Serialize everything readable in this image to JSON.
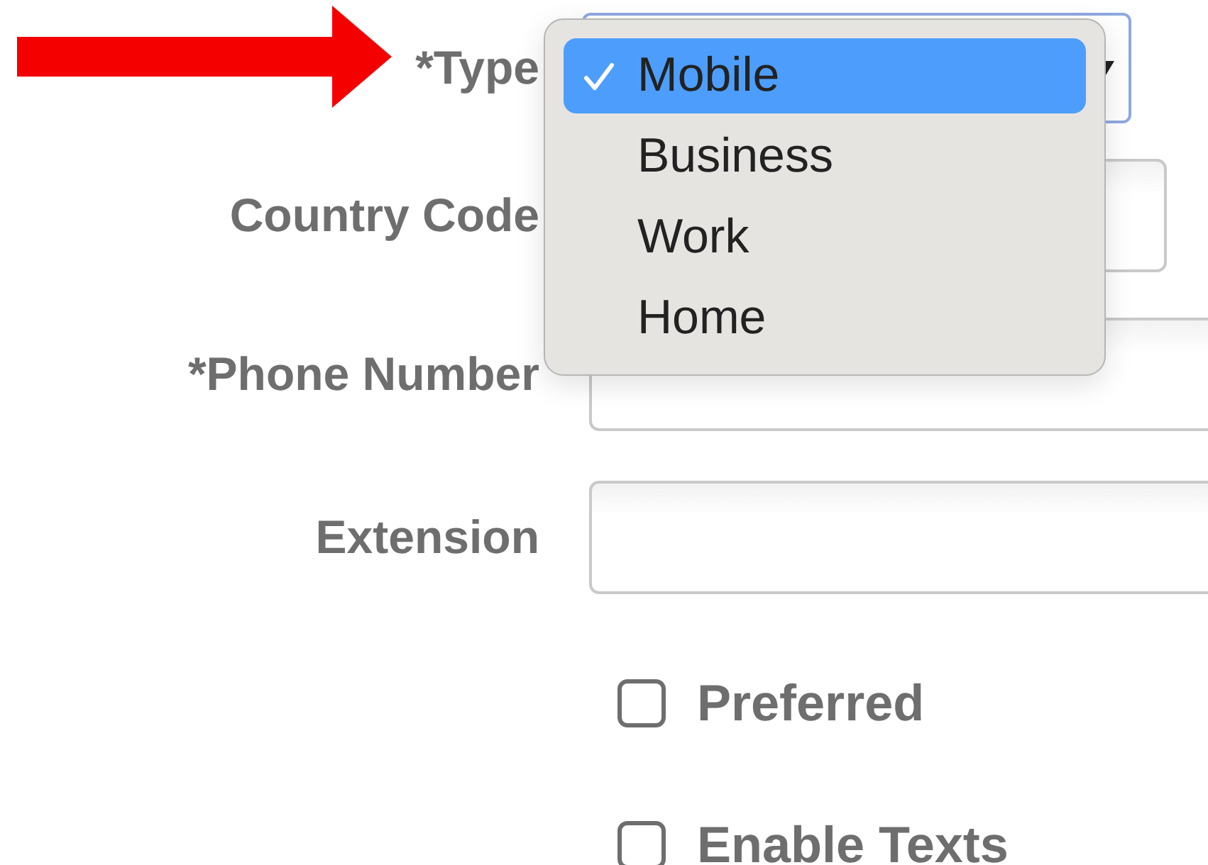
{
  "form": {
    "fields": [
      {
        "label": "*Type",
        "kind": "select"
      },
      {
        "label": "Country Code",
        "kind": "short"
      },
      {
        "label": "*Phone Number",
        "kind": "text"
      },
      {
        "label": "Extension",
        "kind": "text"
      }
    ],
    "checkboxes": [
      {
        "label": "Preferred",
        "checked": false
      },
      {
        "label": "Enable Texts",
        "checked": false
      }
    ]
  },
  "type_menu": {
    "options": [
      {
        "label": "Mobile",
        "selected": true
      },
      {
        "label": "Business",
        "selected": false
      },
      {
        "label": "Work",
        "selected": false
      },
      {
        "label": "Home",
        "selected": false
      }
    ]
  }
}
